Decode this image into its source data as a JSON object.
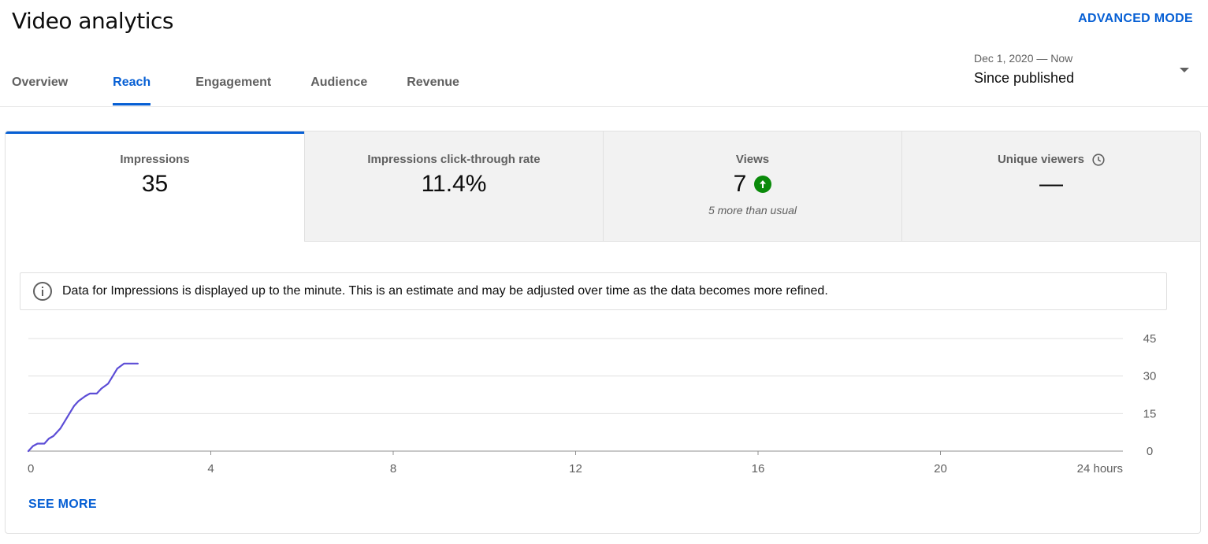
{
  "header": {
    "title": "Video analytics",
    "advanced_mode": "ADVANCED MODE"
  },
  "tabs": [
    {
      "label": "Overview",
      "active": false
    },
    {
      "label": "Reach",
      "active": true
    },
    {
      "label": "Engagement",
      "active": false
    },
    {
      "label": "Audience",
      "active": false
    },
    {
      "label": "Revenue",
      "active": false
    }
  ],
  "date_selector": {
    "range": "Dec 1, 2020 — Now",
    "label": "Since published",
    "icon": "caret-down-icon"
  },
  "metrics": [
    {
      "label": "Impressions",
      "value": "35",
      "sub": "",
      "active": true
    },
    {
      "label": "Impressions click-through rate",
      "value": "11.4%",
      "sub": "",
      "active": false
    },
    {
      "label": "Views",
      "value": "7",
      "sub": "5 more than usual",
      "trend_icon": "arrow-up-icon",
      "active": false
    },
    {
      "label": "Unique viewers",
      "value": "—",
      "sub": "",
      "label_icon": "clock-icon",
      "active": false
    }
  ],
  "notice": {
    "icon": "info-icon",
    "text": "Data for Impressions is displayed up to the minute. This is an estimate and may be adjusted over time as the data becomes more refined."
  },
  "see_more": "SEE MORE",
  "colors": {
    "accent": "#065fd4",
    "line": "#5c4dd6",
    "positive": "#0a8a0a",
    "inactive_tab_bg": "#f2f2f2"
  },
  "chart_data": {
    "type": "line",
    "x_tick_labels": [
      "0",
      "4",
      "8",
      "12",
      "16",
      "20",
      "24 hours"
    ],
    "x_ticks": [
      0,
      4,
      8,
      12,
      16,
      20,
      24
    ],
    "y_tick_labels": [
      "0",
      "15",
      "30",
      "45"
    ],
    "y_ticks": [
      0,
      15,
      30,
      45
    ],
    "xlim": [
      0,
      24
    ],
    "ylim": [
      0,
      45
    ],
    "grid": true,
    "series": [
      {
        "x": [
          0,
          0.1,
          0.2,
          0.35,
          0.45,
          0.55,
          0.7,
          0.8,
          0.9,
          1.0,
          1.1,
          1.25,
          1.35,
          1.5,
          1.6,
          1.75,
          1.85,
          1.95,
          2.1,
          2.25,
          2.4
        ],
        "values": [
          0,
          2,
          3,
          3,
          5,
          6,
          9,
          12,
          15,
          18,
          20,
          22,
          23,
          23,
          25,
          27,
          30,
          33,
          35,
          35,
          35
        ]
      }
    ]
  }
}
